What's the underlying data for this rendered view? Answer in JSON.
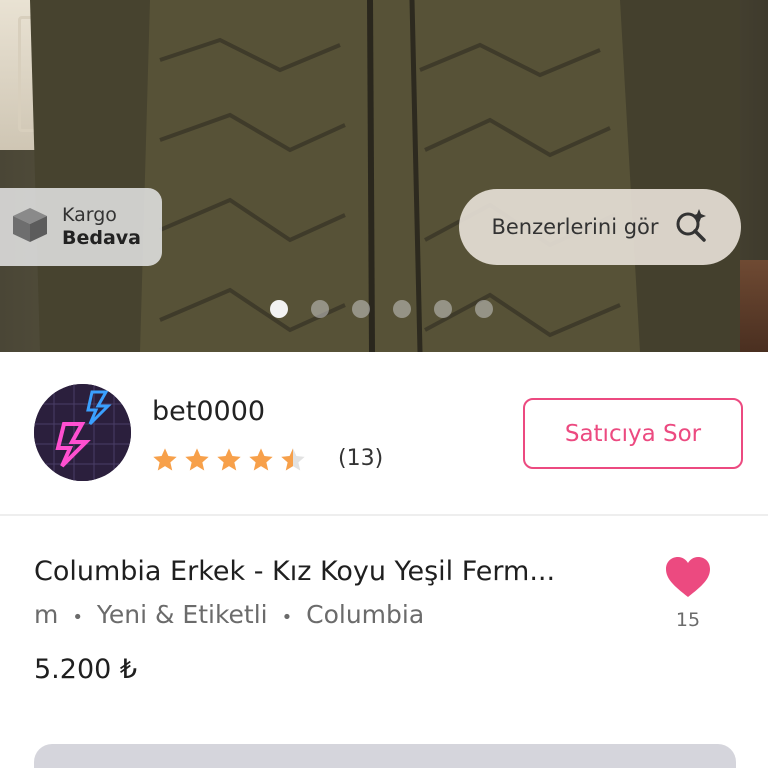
{
  "product_image": {
    "cargo_badge": {
      "line1": "Kargo",
      "line2": "Bedava",
      "icon": "package-icon"
    },
    "similar_button": {
      "label": "Benzerlerini gör",
      "icon": "visual-search-icon"
    },
    "carousel": {
      "total": 6,
      "active_index": 0
    }
  },
  "seller": {
    "name": "bet0000",
    "rating": 4.5,
    "rating_count": "(13)",
    "ask_button": "Satıcıya Sor"
  },
  "product": {
    "title": "Columbia Erkek - Kız Koyu Yeşil  Ferm...",
    "size": "m",
    "separator": "•",
    "condition": "Yeni & Etiketli",
    "brand": "Columbia",
    "price": "5.200 ₺",
    "likes": "15"
  },
  "colors": {
    "accent_pink": "#ec4a80",
    "star_orange": "#f7a04a"
  }
}
